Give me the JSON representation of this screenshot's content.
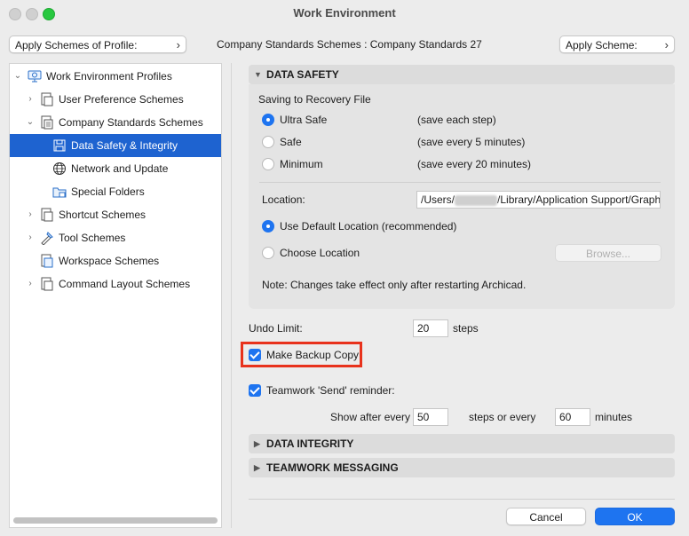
{
  "window": {
    "title": "Work Environment"
  },
  "toolbar": {
    "apply_profile_label": "Apply Schemes of Profile:",
    "standards_label": "Company Standards Schemes :",
    "standards_value": "Company Standards 27",
    "apply_scheme_label": "Apply Scheme:"
  },
  "tree": {
    "items": [
      {
        "label": "Work Environment Profiles",
        "icon": "profiles-icon"
      },
      {
        "label": "User Preference Schemes",
        "icon": "scheme-icon"
      },
      {
        "label": "Company Standards Schemes",
        "icon": "scheme-icon"
      },
      {
        "label": "Data Safety & Integrity",
        "icon": "data-safety-icon"
      },
      {
        "label": "Network and Update",
        "icon": "globe-icon"
      },
      {
        "label": "Special Folders",
        "icon": "folder-icon"
      },
      {
        "label": "Shortcut Schemes",
        "icon": "scheme-icon"
      },
      {
        "label": "Tool Schemes",
        "icon": "tool-icon"
      },
      {
        "label": "Workspace Schemes",
        "icon": "scheme-icon"
      },
      {
        "label": "Command Layout Schemes",
        "icon": "scheme-icon"
      }
    ]
  },
  "data_safety": {
    "header": "DATA SAFETY",
    "recovery_title": "Saving to Recovery File",
    "options": [
      {
        "label": "Ultra Safe",
        "desc": "(save each step)",
        "selected": true
      },
      {
        "label": "Safe",
        "desc": "(save every 5 minutes)",
        "selected": false
      },
      {
        "label": "Minimum",
        "desc": "(save every 20 minutes)",
        "selected": false
      }
    ],
    "location_label": "Location:",
    "location_prefix": "/Users/",
    "location_suffix": "/Library/Application Support/Graphisoft",
    "default_location": "Use Default Location (recommended)",
    "choose_location": "Choose Location",
    "browse": "Browse...",
    "note": "Note: Changes take effect only after restarting Archicad."
  },
  "undo": {
    "label": "Undo Limit:",
    "value": "20",
    "unit": "steps"
  },
  "backup": {
    "label": "Make Backup Copy",
    "checked": true
  },
  "teamwork": {
    "label": "Teamwork 'Send' reminder:",
    "checked": true,
    "show_after": "Show after every",
    "steps_value": "50",
    "steps_or_every": "steps or every",
    "minutes_value": "60",
    "minutes": "minutes"
  },
  "sections": {
    "data_integrity": "DATA INTEGRITY",
    "teamwork_messaging": "TEAMWORK MESSAGING"
  },
  "footer": {
    "cancel": "Cancel",
    "ok": "OK"
  },
  "colors": {
    "accent": "#1e74f0",
    "selection": "#1e63d0",
    "highlight": "#e8321c"
  }
}
